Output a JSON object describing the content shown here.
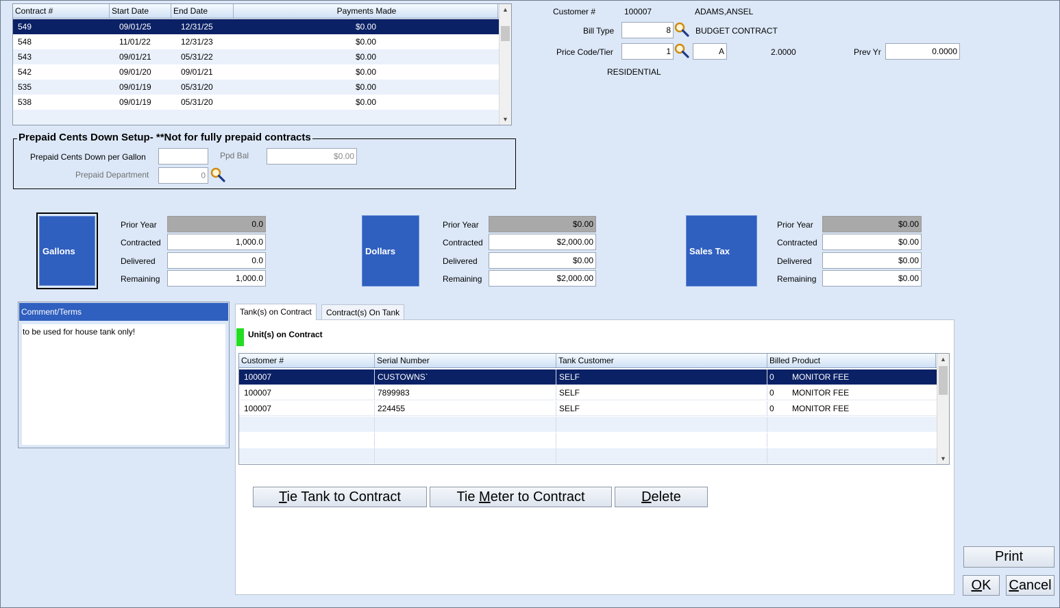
{
  "contracts": {
    "columns": [
      "Contract #",
      "Start Date",
      "End Date",
      "Payments Made"
    ],
    "rows": [
      {
        "contract": "549",
        "start": "09/01/25",
        "end": "12/31/25",
        "payments": "$0.00"
      },
      {
        "contract": "548",
        "start": "11/01/22",
        "end": "12/31/23",
        "payments": "$0.00"
      },
      {
        "contract": "543",
        "start": "09/01/21",
        "end": "05/31/22",
        "payments": "$0.00"
      },
      {
        "contract": "542",
        "start": "09/01/20",
        "end": "09/01/21",
        "payments": "$0.00"
      },
      {
        "contract": "535",
        "start": "09/01/19",
        "end": "05/31/20",
        "payments": "$0.00"
      },
      {
        "contract": "538",
        "start": "09/01/19",
        "end": "05/31/20",
        "payments": "$0.00"
      }
    ]
  },
  "customer": {
    "label": "Customer #",
    "number": "100007",
    "name": "ADAMS,ANSEL",
    "bill_type_label": "Bill Type",
    "bill_type": "8",
    "bill_type_desc": "BUDGET CONTRACT",
    "price_code_label": "Price Code/Tier",
    "price_code": "1",
    "tier": "A",
    "price": "2.0000",
    "prev_yr_label": "Prev Yr",
    "prev_yr": "0.0000",
    "price_desc": "RESIDENTIAL"
  },
  "prepaid": {
    "title": "Prepaid Cents Down Setup- **Not for fully prepaid contracts",
    "cents_label": "Prepaid Cents Down per Gallon",
    "cents_value": "",
    "ppd_bal_label": "Ppd Bal",
    "ppd_bal": "$0.00",
    "dept_label": "Prepaid Department",
    "dept_value": "0"
  },
  "summary_labels": {
    "prior_year": "Prior Year",
    "contracted": "Contracted",
    "delivered": "Delivered",
    "remaining": "Remaining"
  },
  "gallons": {
    "title": "Gallons",
    "prior_year": "0.0",
    "contracted": "1,000.0",
    "delivered": "0.0",
    "remaining": "1,000.0"
  },
  "dollars": {
    "title": "Dollars",
    "prior_year": "$0.00",
    "contracted": "$2,000.00",
    "delivered": "$0.00",
    "remaining": "$2,000.00"
  },
  "sales_tax": {
    "title": "Sales Tax",
    "prior_year": "$0.00",
    "contracted": "$0.00",
    "delivered": "$0.00",
    "remaining": "$0.00"
  },
  "comment": {
    "title": "Comment/Terms",
    "text": "to be used for house tank only!"
  },
  "tabs": [
    {
      "label": "Tank(s) on Contract"
    },
    {
      "label": "Contract(s) On Tank"
    }
  ],
  "units": {
    "title": "Unit(s) on Contract",
    "indicator_color": "#22dd22",
    "columns": [
      "Customer #",
      "Serial Number",
      "Tank Customer",
      "Billed Product"
    ],
    "rows": [
      {
        "customer": "100007",
        "serial": "CUSTOWNS`",
        "tank_customer": "SELF",
        "qty": "0",
        "product": "MONITOR FEE"
      },
      {
        "customer": "100007",
        "serial": "7899983",
        "tank_customer": "SELF",
        "qty": "0",
        "product": "MONITOR FEE"
      },
      {
        "customer": "100007",
        "serial": "224455",
        "tank_customer": "SELF",
        "qty": "0",
        "product": "MONITOR FEE"
      }
    ]
  },
  "buttons": {
    "tie_tank": {
      "pre": "",
      "u": "T",
      "post": "ie Tank to Contract"
    },
    "tie_meter": {
      "pre": "Tie ",
      "u": "M",
      "post": "eter to Contract"
    },
    "delete": {
      "pre": "",
      "u": "D",
      "post": "elete"
    },
    "print": "Print",
    "ok": {
      "pre": "",
      "u": "O",
      "post": "K"
    },
    "cancel": {
      "pre": "",
      "u": "C",
      "post": "ancel"
    }
  },
  "icons": {
    "lookup": "magnifier-icon",
    "scroll_up": "chevron-up-icon",
    "scroll_down": "chevron-down-icon"
  }
}
